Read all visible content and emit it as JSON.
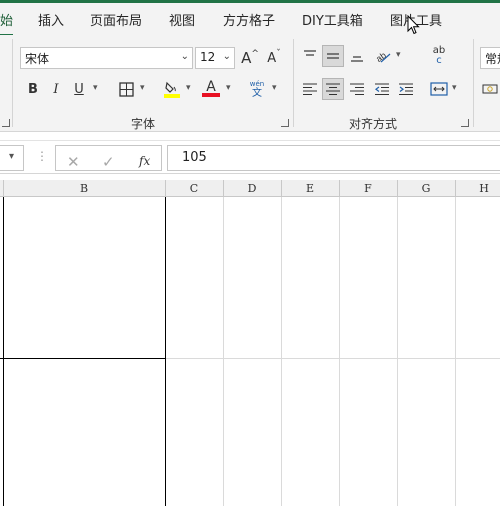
{
  "tabs": [
    {
      "label": "始",
      "active": true
    },
    {
      "label": "插入"
    },
    {
      "label": "页面布局"
    },
    {
      "label": "视图"
    },
    {
      "label": "方方格子"
    },
    {
      "label": "DIY工具箱"
    },
    {
      "label": "图片工具"
    }
  ],
  "font_group": {
    "font_name": "宋体",
    "font_size": "12",
    "label": "字体",
    "grow_label": "A",
    "shrink_label": "A",
    "bold": "B",
    "italic": "I",
    "underline": "U",
    "font_color_label": "A",
    "phonetic_top": "wén",
    "phonetic_bottom": "文",
    "highlight_color": "#ffff00",
    "font_color": "#e81123"
  },
  "align_group": {
    "label": "对齐方式",
    "wrap_top": "ab",
    "wrap_bottom": "c"
  },
  "number_group": {
    "format_value": "常规"
  },
  "formula_bar": {
    "content": "105"
  },
  "columns": [
    "B",
    "C",
    "D",
    "E",
    "F",
    "G",
    "H"
  ],
  "colors": {
    "accent": "#217346",
    "ribbon_bg": "#f3f3f3"
  }
}
